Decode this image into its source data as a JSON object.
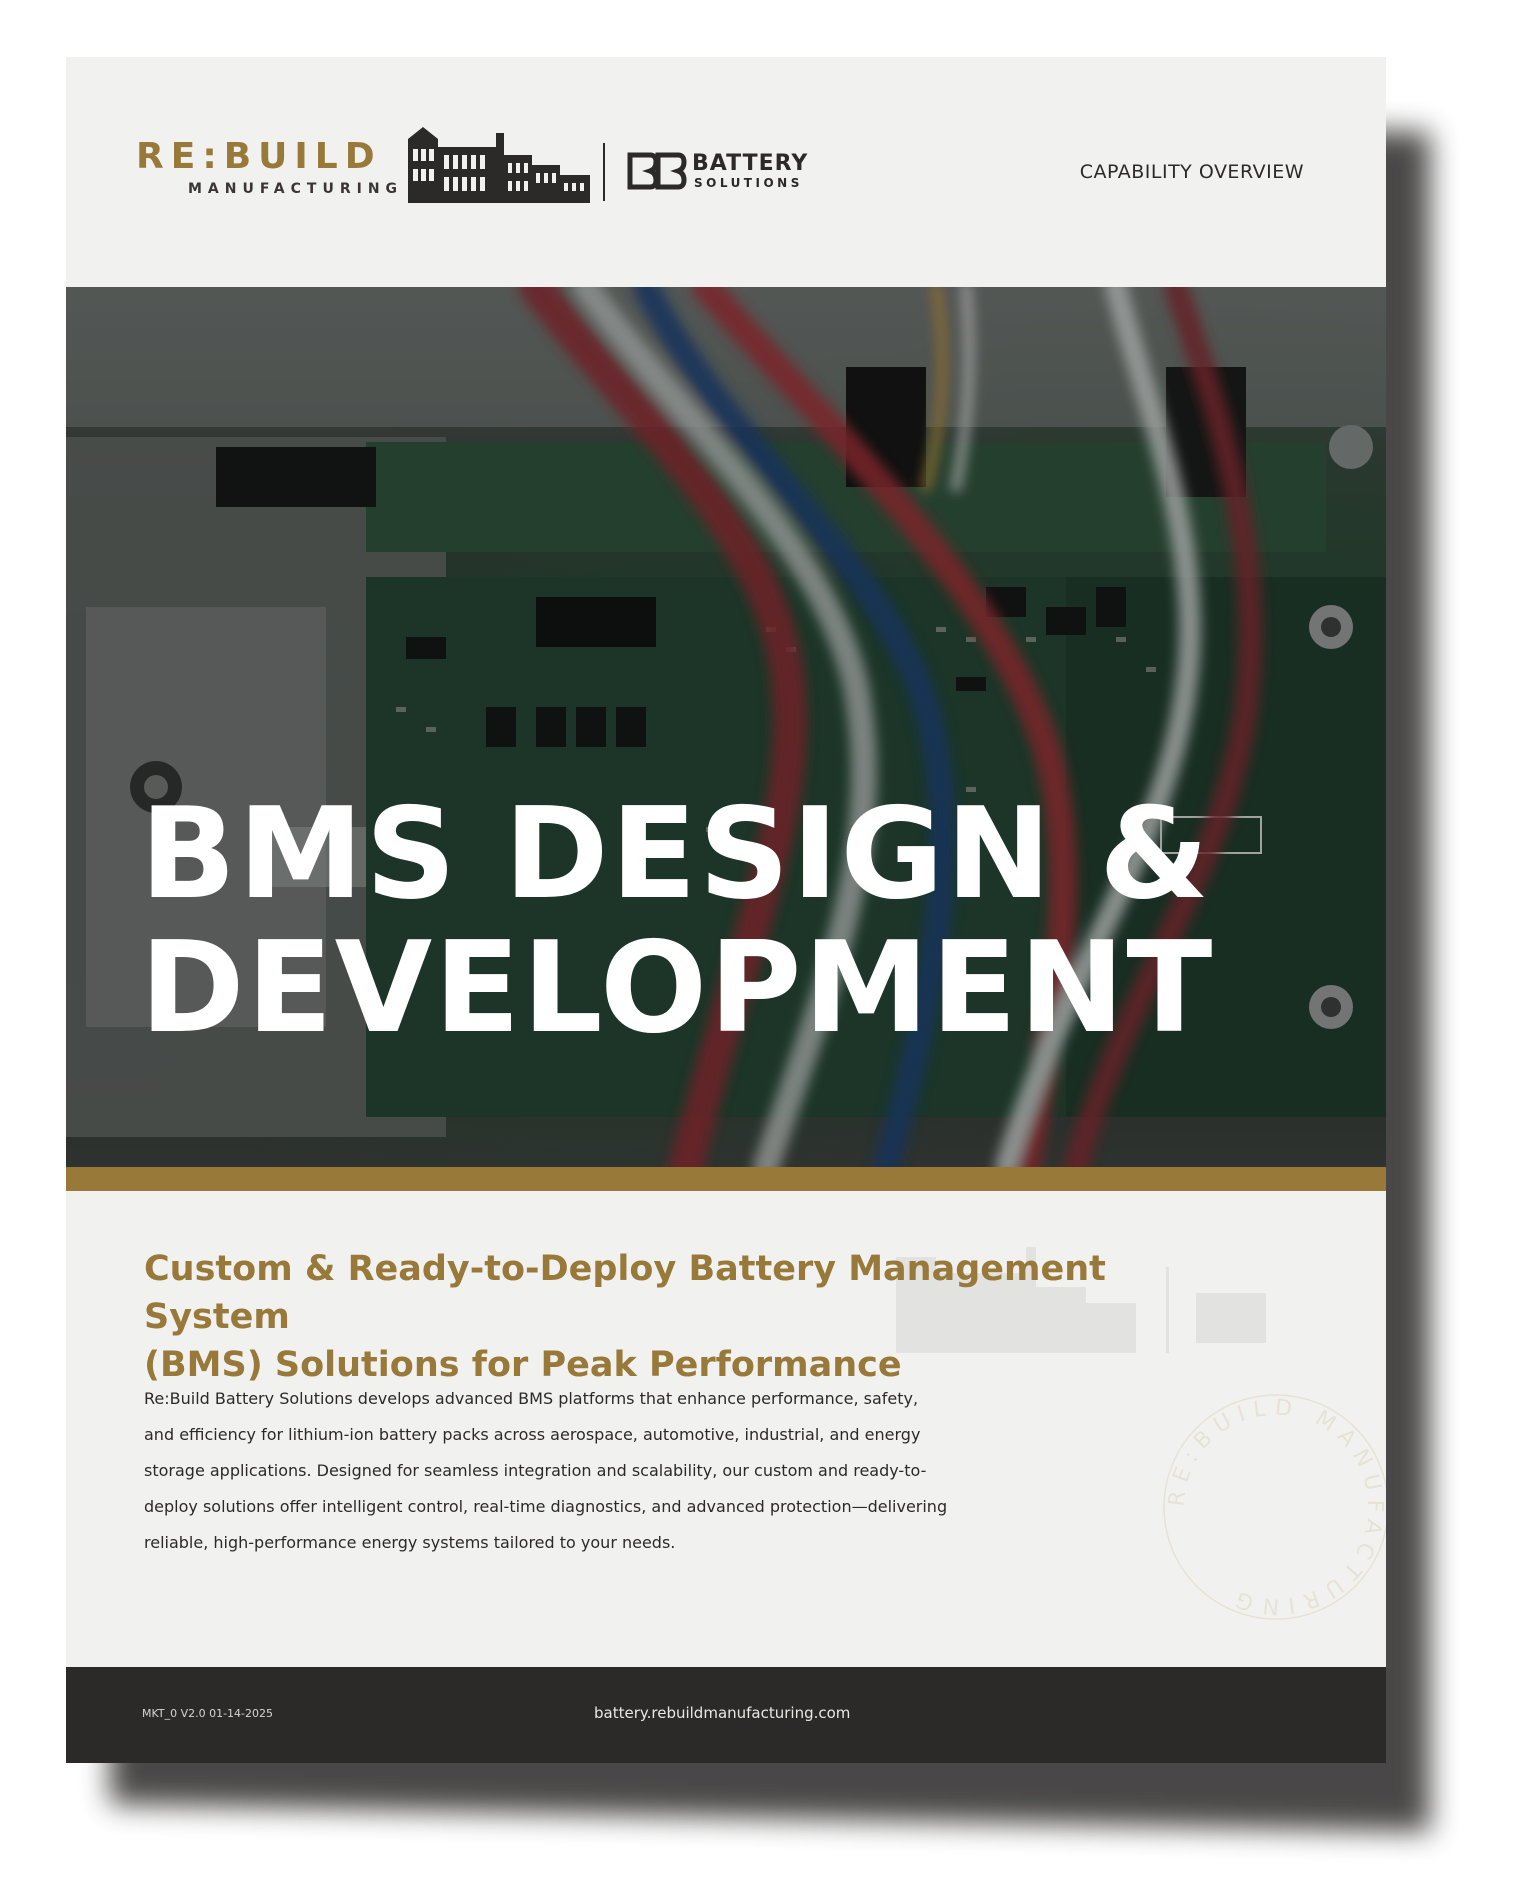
{
  "header": {
    "brand_word": "RE:BUILD",
    "brand_sub": "MANUFACTURING",
    "partner_word": "BATTERY",
    "partner_sub": "SOLUTIONS",
    "doc_type": "CAPABILITY OVERVIEW"
  },
  "hero": {
    "title_line1": "BMS DESIGN &",
    "title_line2": "DEVELOPMENT"
  },
  "content": {
    "subtitle_line1": "Custom & Ready-to-Deploy Battery Management System",
    "subtitle_line2": "(BMS) Solutions for Peak Performance",
    "body_lines": [
      "Re:Build Battery Solutions develops advanced BMS platforms that enhance performance, safety,",
      "and efficiency for lithium-ion battery packs across aerospace, automotive, industrial, and energy",
      "storage applications. Designed for seamless integration and scalability, our custom and ready-to-",
      "deploy solutions offer intelligent control, real-time diagnostics, and advanced protection—delivering",
      "reliable, high-performance energy systems tailored to your needs."
    ]
  },
  "seal": {
    "text": "RE:BUILD MANUFACTURING"
  },
  "footer": {
    "version": "MKT_0 V2.0 01-14-2025",
    "url": "battery.rebuildmanufacturing.com"
  },
  "colors": {
    "gold": "#98793a",
    "dark": "#2c2a29",
    "page_bg": "#f1f2f0"
  }
}
